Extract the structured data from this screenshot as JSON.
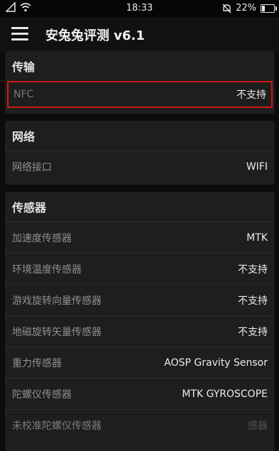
{
  "status_bar": {
    "time": "18:33",
    "battery": "22%",
    "battery_level": 0.22,
    "icons": [
      "signal-icon",
      "wifi-icon",
      "alarm-off-icon",
      "battery-icon"
    ]
  },
  "app_bar": {
    "title": "安兔兔评测 v6.1",
    "menu_icon": "hamburger-menu-icon"
  },
  "sections": {
    "transfer": {
      "header": "传输",
      "rows": [
        {
          "label": "NFC",
          "value": "不支持"
        }
      ]
    },
    "network": {
      "header": "网络",
      "rows": [
        {
          "label": "网络接口",
          "value": "WIFI"
        }
      ]
    },
    "sensors": {
      "header": "传感器",
      "rows": [
        {
          "label": "加速度传感器",
          "value": "MTK"
        },
        {
          "label": "环境温度传感器",
          "value": "不支持"
        },
        {
          "label": "游戏旋转向量传感器",
          "value": "不支持"
        },
        {
          "label": "地磁旋转矢量传感器",
          "value": "不支持"
        },
        {
          "label": "重力传感器",
          "value": "AOSP Gravity Sensor"
        },
        {
          "label": "陀螺仪传感器",
          "value": "MTK GYROSCOPE"
        },
        {
          "label": "未校准陀螺仪传感器",
          "value": "感器"
        }
      ]
    }
  },
  "colors": {
    "background": "#0c0c0c",
    "card": "#1e1e1e",
    "highlight_border": "#d01818"
  }
}
